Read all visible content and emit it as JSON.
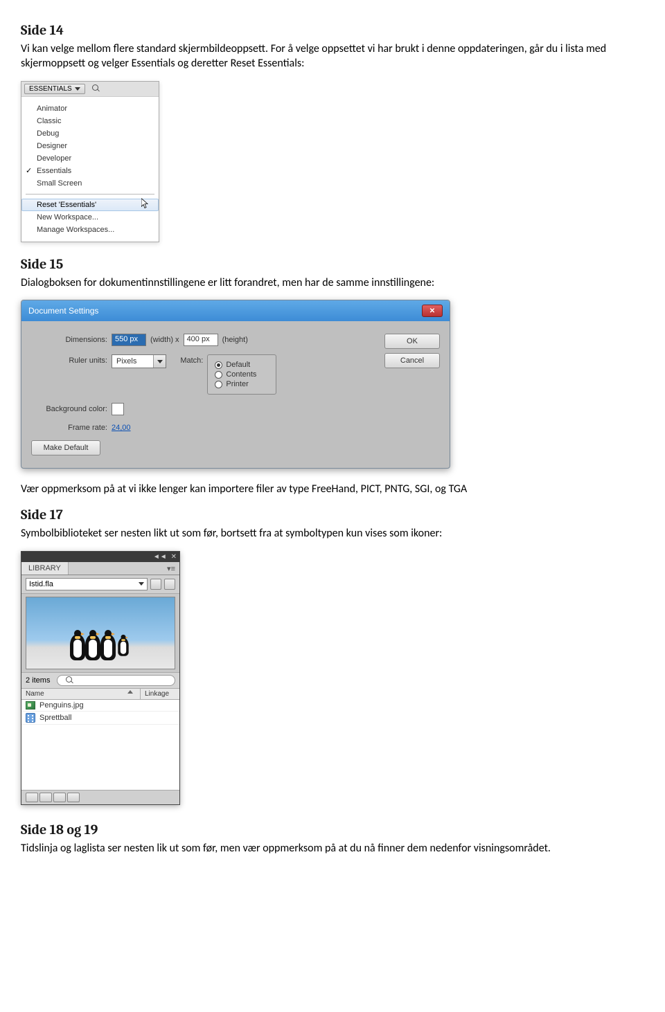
{
  "sections": {
    "s14": {
      "heading": "Side 14",
      "text": "Vi kan velge mellom flere standard skjermbildeoppsett. For å velge oppsettet vi har brukt i denne oppdateringen, går du i lista med skjermoppsett og velger Essentials og deretter Reset Essentials:"
    },
    "s15": {
      "heading": "Side 15",
      "text": "Dialogboksen for dokumentinnstillingene er litt forandret, men har de samme innstillingene:",
      "note": "Vær oppmerksom på at vi ikke lenger kan importere filer av type FreeHand, PICT, PNTG, SGI, og TGA"
    },
    "s17": {
      "heading": "Side 17",
      "text": "Symbolbiblioteket ser nesten likt ut som før, bortsett fra at symboltypen kun vises som ikoner:"
    },
    "s18": {
      "heading": "Side 18 og 19",
      "text": "Tidslinja og laglista ser nesten lik ut som før, men vær oppmerksom på at du nå finner dem nedenfor visningsområdet."
    }
  },
  "workspace": {
    "button": "ESSENTIALS",
    "items": [
      "Animator",
      "Classic",
      "Debug",
      "Designer",
      "Developer",
      "Essentials",
      "Small Screen"
    ],
    "checked": "Essentials",
    "actions": [
      "Reset 'Essentials'",
      "New Workspace...",
      "Manage Workspaces..."
    ],
    "hovered": "Reset 'Essentials'"
  },
  "docSettings": {
    "title": "Document Settings",
    "dimensionsLabel": "Dimensions:",
    "widthValue": "550 px",
    "widthxLabel": "(width) x",
    "heightValue": "400 px",
    "heightLabel": "(height)",
    "rulerLabel": "Ruler units:",
    "rulerValue": "Pixels",
    "matchLabel": "Match:",
    "matchOptions": [
      "Default",
      "Contents",
      "Printer"
    ],
    "matchSelected": "Default",
    "bgLabel": "Background color:",
    "frLabel": "Frame rate:",
    "frValue": "24,00",
    "btnDefault": "Make Default",
    "btnOK": "OK",
    "btnCancel": "Cancel"
  },
  "library": {
    "tab": "LIBRARY",
    "file": "Istid.fla",
    "count": "2 items",
    "colName": "Name",
    "colLinkage": "Linkage",
    "items": [
      {
        "icon": "bitmap",
        "name": "Penguins.jpg"
      },
      {
        "icon": "movieclip",
        "name": "Sprettball"
      }
    ]
  }
}
